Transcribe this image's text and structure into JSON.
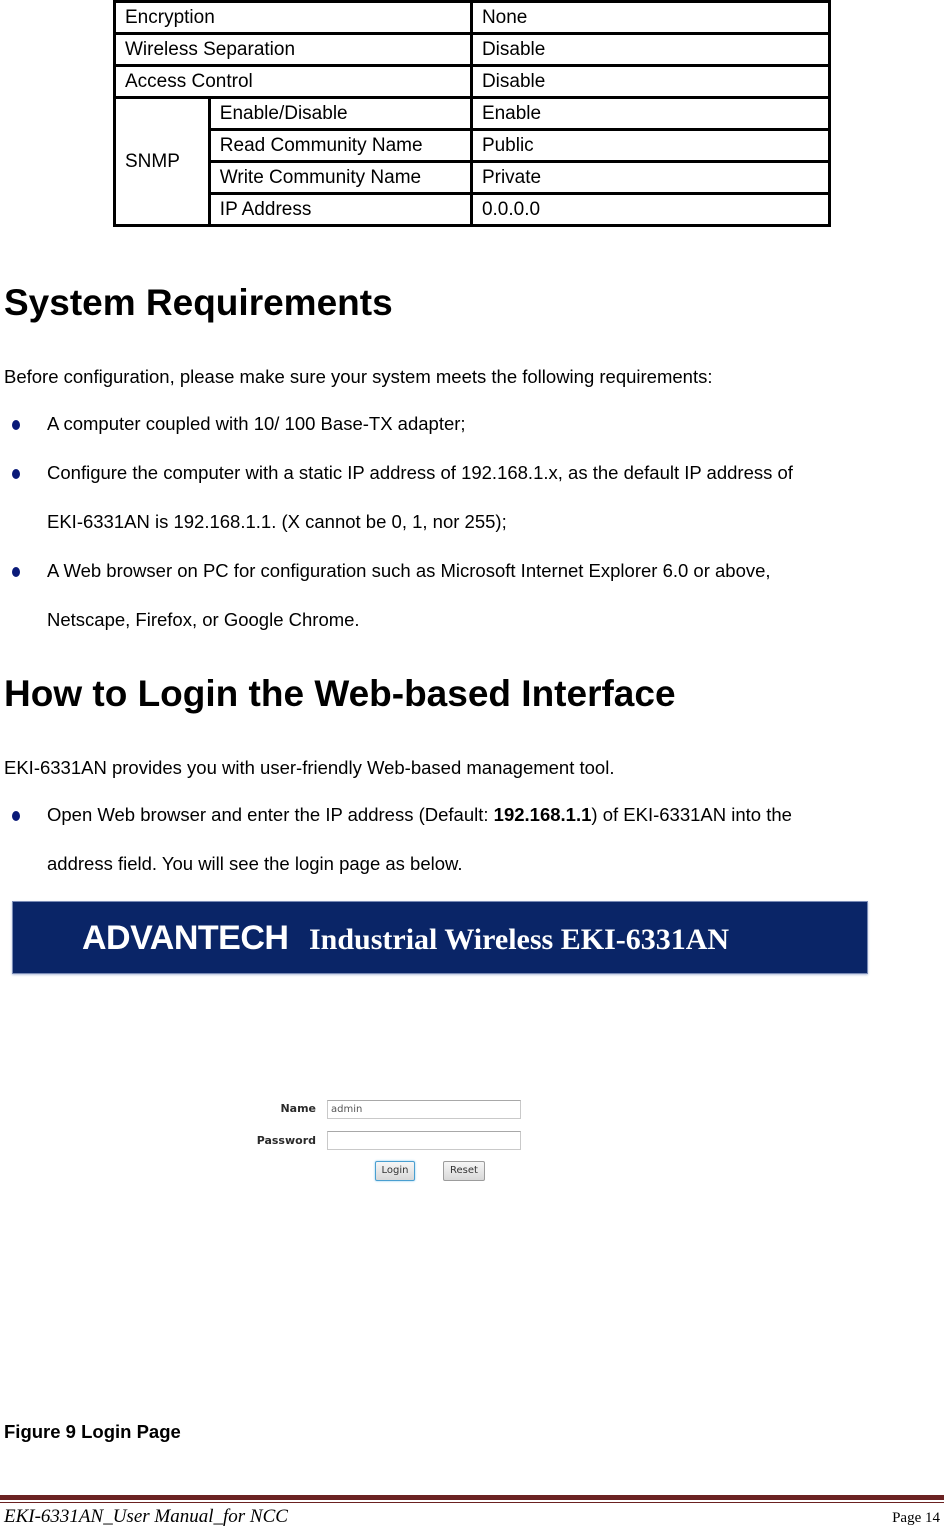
{
  "config_table": {
    "rows": [
      {
        "label": "Encryption",
        "value": "None"
      },
      {
        "label": "Wireless Separation",
        "value": "Disable"
      },
      {
        "label": "Access Control",
        "value": "Disable"
      }
    ],
    "snmp": {
      "group_label": "SNMP",
      "rows": [
        {
          "label": "Enable/Disable",
          "value": "Enable"
        },
        {
          "label": "Read Community Name",
          "value": "Public"
        },
        {
          "label": "Write Community Name",
          "value": "Private"
        },
        {
          "label": "IP Address",
          "value": "0.0.0.0"
        }
      ]
    }
  },
  "system_requirements": {
    "heading": "System Requirements",
    "intro": "Before configuration, please make sure your system meets the following requirements:",
    "bullets": [
      {
        "lines": [
          "A computer coupled with 10/ 100 Base-TX adapter;"
        ]
      },
      {
        "lines": [
          "Configure the computer with a static IP address of 192.168.1.x, as the default IP address of",
          "EKI-6331AN is 192.168.1.1. (X cannot be 0, 1, nor 255);"
        ]
      },
      {
        "lines": [
          "A Web browser on PC for configuration such as Microsoft Internet Explorer 6.0 or above,",
          "Netscape, Firefox, or Google Chrome."
        ]
      }
    ]
  },
  "login_section": {
    "heading": "How to Login the Web-based Interface",
    "intro": "EKI-6331AN provides you with user-friendly Web-based management tool.",
    "bullet": {
      "line1_pre": "Open Web browser and enter the IP address (Default: ",
      "line1_bold": "192.168.1.1",
      "line1_post": ") of EKI-6331AN into the",
      "line2": "address field. You will see the login page as below."
    }
  },
  "figure": {
    "banner_logo": "ADVANTECH",
    "banner_title": "Industrial Wireless EKI-6331AN",
    "name_label": "Name",
    "name_value": "admin",
    "password_label": "Password",
    "password_value": "",
    "login_button": "Login",
    "reset_button": "Reset",
    "caption": "Figure 9 Login Page"
  },
  "footer": {
    "document_title": "EKI-6331AN_User Manual_for NCC",
    "page_label": "Page 14"
  }
}
